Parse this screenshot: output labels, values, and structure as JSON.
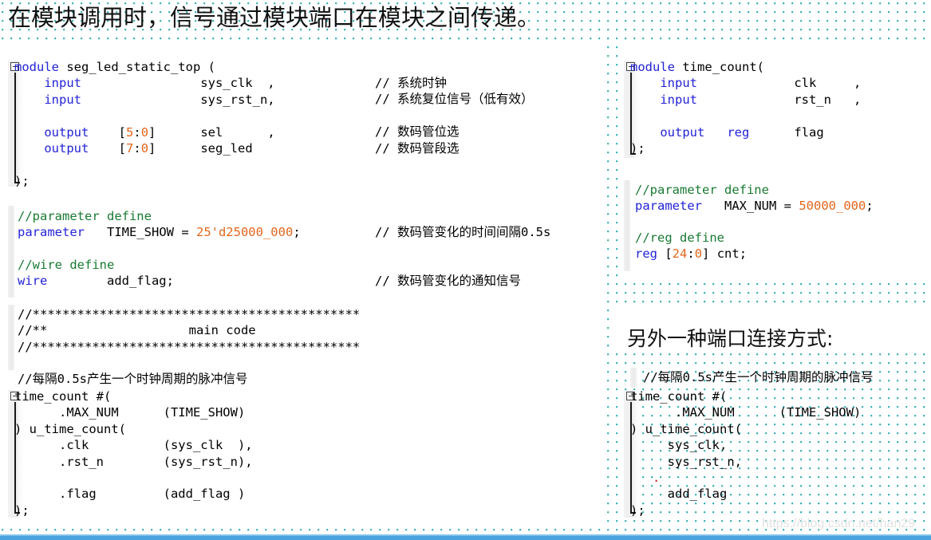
{
  "slide": {
    "title": "在模块调用时，信号通过模块端口在模块之间传递。",
    "watermark": "https://blog.csdn.net/han29"
  },
  "left_panel": {
    "module_header": {
      "code_lines": [
        "module seg_led_static_top (",
        "    input                sys_clk  ,",
        "    input                sys_rst_n,",
        "",
        "    output    [5:0]      sel      ,",
        "    output    [7:0]      seg_led",
        "",
        ");"
      ],
      "comments": [
        "// 系统时钟",
        "// 系统复位信号（低有效）",
        "",
        "// 数码管位选",
        "// 数码管段选"
      ]
    },
    "parameter_block": {
      "code_lines": [
        "//parameter define",
        "parameter   TIME_SHOW = 25'd25000_000;"
      ],
      "comment": "// 数码管变化的时间间隔0.5s"
    },
    "wire_block": {
      "code_lines": [
        "//wire define",
        "wire        add_flag;"
      ],
      "comment": "// 数码管变化的通知信号"
    },
    "separator": {
      "line1": "//********************************************",
      "line2": "//**                   main code",
      "line3": "//********************************************"
    },
    "instance": {
      "comment": "//每隔0.5s产生一个时钟周期的脉冲信号",
      "code_lines": [
        "time_count #(",
        "      .MAX_NUM      (TIME_SHOW)",
        ") u_time_count(",
        "      .clk          (sys_clk  ),",
        "      .rst_n        (sys_rst_n),",
        "",
        "      .flag         (add_flag )",
        ");"
      ]
    }
  },
  "right_panel": {
    "module_header": {
      "code_lines": [
        "module time_count(",
        "    input             clk     ,",
        "    input             rst_n   ,",
        "",
        "    output   reg      flag",
        ");"
      ]
    },
    "parameter_block": {
      "code_lines": [
        "//parameter define",
        "parameter   MAX_NUM = 50000_000;"
      ]
    },
    "reg_block": {
      "code_lines": [
        "//reg define",
        "reg [24:0] cnt;"
      ]
    },
    "alt_heading": "另外一种端口连接方式:",
    "alt_instance": {
      "comment": "//每隔0.5s产生一个时钟周期的脉冲信号",
      "code_lines": [
        "time_count #(",
        "      .MAX_NUM      (TIME_SHOW)",
        ") u_time_count(",
        "     sys_clk,",
        "     sys_rst_n,",
        "   .",
        "     add_flag",
        ");"
      ]
    }
  },
  "colors": {
    "keyword": "#2323d8",
    "number": "#e2661c",
    "comment": "#1a7a33",
    "dot_pattern": "#37b0b5",
    "bottom_bar": "#4aa3df"
  }
}
